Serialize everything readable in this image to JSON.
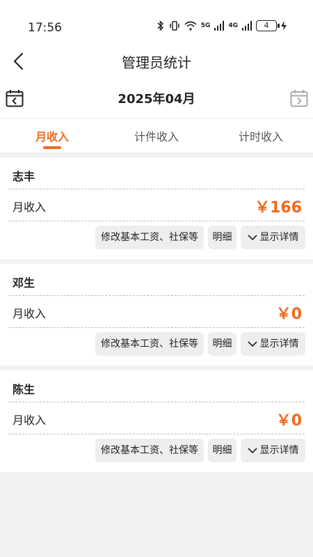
{
  "status": {
    "time": "17:56",
    "battery": "4",
    "net1": "5G",
    "net2": "4G"
  },
  "header": {
    "title": "管理员统计"
  },
  "month": {
    "label": "2025年04月"
  },
  "tabs": [
    "月收入",
    "计件收入",
    "计时收入"
  ],
  "cards": [
    {
      "name": "志丰",
      "row_label": "月收入",
      "amount": "￥166"
    },
    {
      "name": "邓生",
      "row_label": "月收入",
      "amount": "￥0"
    },
    {
      "name": "陈生",
      "row_label": "月收入",
      "amount": "￥0"
    }
  ],
  "actions": {
    "modify": "修改基本工资、社保等",
    "detail": "明细",
    "show_details": "显示详情"
  },
  "colors": {
    "accent": "#ef6a1f",
    "background": "#f2f2f2"
  }
}
